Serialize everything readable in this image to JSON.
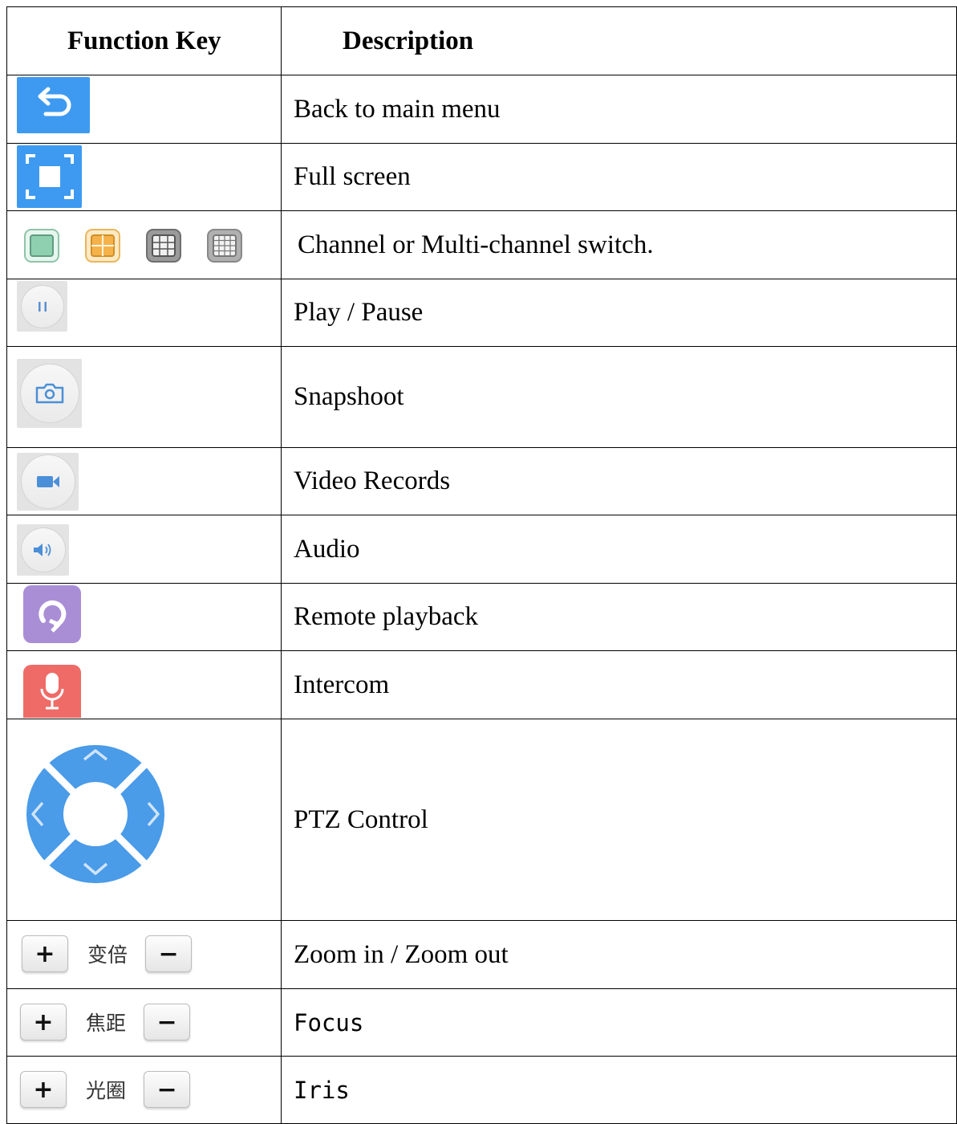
{
  "table": {
    "headers": {
      "key": "Function Key",
      "description": "Description"
    },
    "rows": [
      {
        "icon": "back-icon",
        "description": "Back to main menu"
      },
      {
        "icon": "fullscreen-icon",
        "description": "Full screen"
      },
      {
        "icon": "channel-layout-icons",
        "description": "Channel or Multi-channel switch."
      },
      {
        "icon": "pause-icon",
        "description": "Play / Pause"
      },
      {
        "icon": "camera-icon",
        "description": "Snapshoot"
      },
      {
        "icon": "video-camera-icon",
        "description": "Video Records"
      },
      {
        "icon": "speaker-icon",
        "description": "Audio"
      },
      {
        "icon": "playback-icon",
        "description": "Remote playback"
      },
      {
        "icon": "microphone-icon",
        "description": "Intercom"
      },
      {
        "icon": "ptz-dpad-icon",
        "description": "PTZ Control"
      },
      {
        "icon": "zoom-stepper",
        "label": "变倍",
        "plus": "+",
        "minus": "−",
        "description": "Zoom in / Zoom out"
      },
      {
        "icon": "focus-stepper",
        "label": "焦距",
        "plus": "+",
        "minus": "−",
        "description": "Focus"
      },
      {
        "icon": "iris-stepper",
        "label": "光圈",
        "plus": "+",
        "minus": "−",
        "description": "Iris"
      }
    ]
  },
  "colors": {
    "blue": "#3d9af0",
    "green_channel": "#8fd0b0",
    "orange_channel": "#f5b24a",
    "grey_channel": "#8a8a8a",
    "purple": "#a98ed6",
    "red": "#ee6b67",
    "ptz_blue": "#4a9be8"
  }
}
